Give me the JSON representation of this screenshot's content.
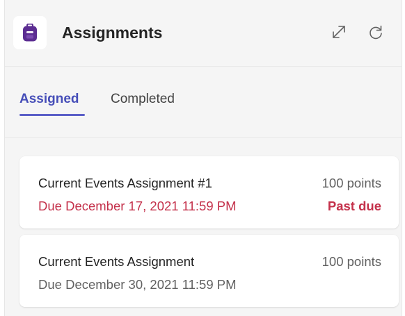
{
  "app": {
    "title": "Assignments",
    "icon": "backpack-icon",
    "icon_color": "#5b2c91"
  },
  "header_actions": [
    {
      "name": "expand",
      "icon": "expand-icon"
    },
    {
      "name": "refresh",
      "icon": "refresh-icon"
    }
  ],
  "tabs": {
    "assigned": {
      "label": "Assigned",
      "selected": true
    },
    "completed": {
      "label": "Completed",
      "selected": false
    }
  },
  "colors": {
    "accent": "#5b5fc7",
    "past_due": "#c4314b",
    "background": "#f5f5f5"
  },
  "assignments": [
    {
      "title": "Current Events Assignment #1",
      "due": "Due December 17, 2021 11:59 PM",
      "points": "100 points",
      "status": "Past due"
    },
    {
      "title": "Current Events Assignment",
      "due": "Due December 30, 2021 11:59 PM",
      "points": "100 points",
      "status": ""
    }
  ]
}
